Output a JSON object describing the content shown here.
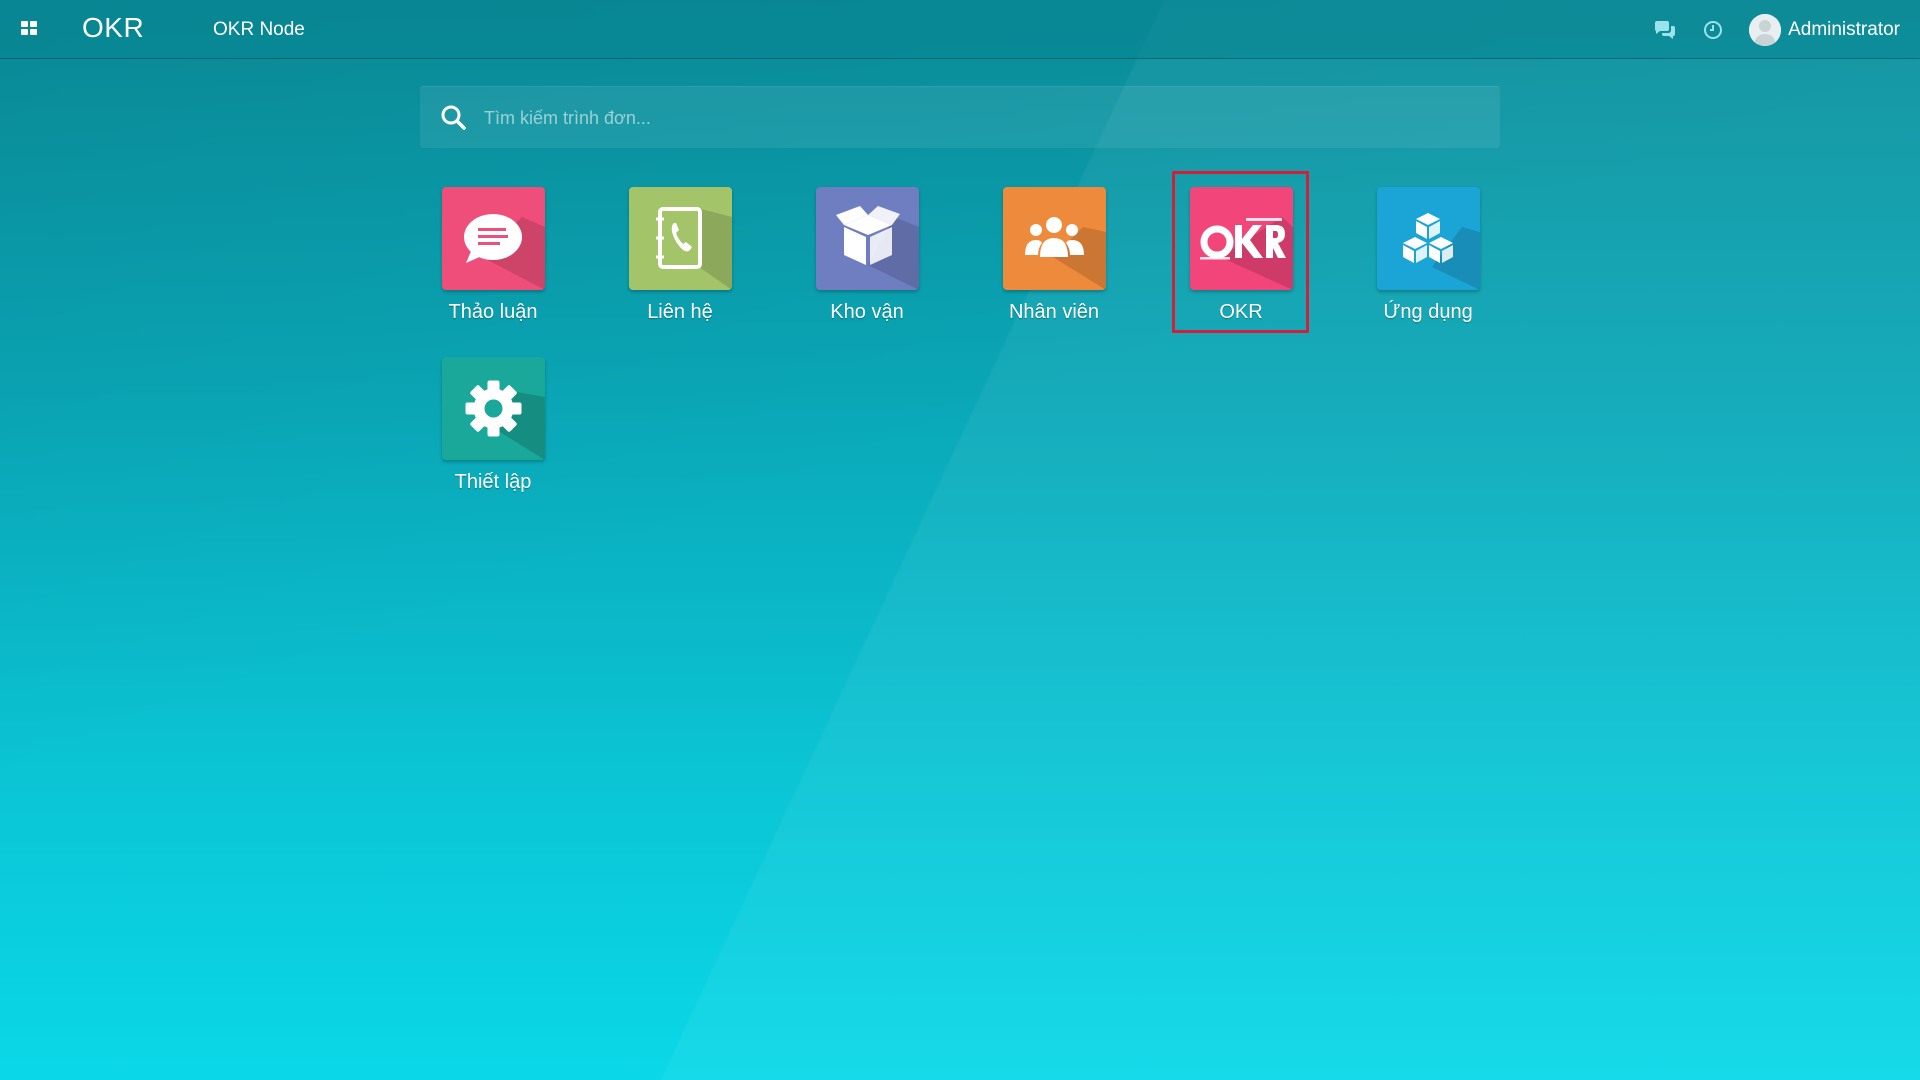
{
  "navbar": {
    "brand": "OKR",
    "company": "OKR Node",
    "user_name": "Administrator",
    "icons": [
      "apps-grid-icon",
      "chat-icon",
      "clock-icon",
      "avatar-icon"
    ]
  },
  "search": {
    "placeholder": "Tìm kiếm trình đơn...",
    "value": ""
  },
  "apps": [
    {
      "label": "Thảo luận",
      "icon": "discuss-icon",
      "color": "#f04e7a"
    },
    {
      "label": "Liên hệ",
      "icon": "contacts-icon",
      "color": "#a4c46a"
    },
    {
      "label": "Kho vận",
      "icon": "inventory-box-icon",
      "color": "#6f7ec0"
    },
    {
      "label": "Nhân viên",
      "icon": "employees-icon",
      "color": "#ee8a3c"
    },
    {
      "label": "OKR",
      "icon": "okr-logo-icon",
      "color": "#f2457a",
      "selected": true
    },
    {
      "label": "Ứng dụng",
      "icon": "apps-cubes-icon",
      "color": "#1ba5d6"
    },
    {
      "label": "Thiết lập",
      "icon": "settings-gear-icon",
      "color": "#1aa89a"
    }
  ],
  "colors": {
    "navbar": "#0a8c99",
    "background_top": "#0a8f9c",
    "background_bottom": "#0ad8e8",
    "selection_border": "#d0203a"
  }
}
